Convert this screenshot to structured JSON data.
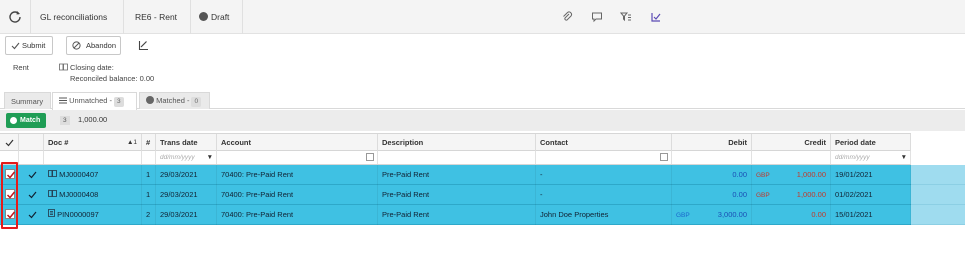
{
  "breadcrumb": {
    "root": "GL reconciliations",
    "item": "RE6 - Rent",
    "status": "Draft"
  },
  "toolbar_icons": [
    "paperclip-icon",
    "comment-icon",
    "filter-icon",
    "tasks-icon"
  ],
  "actions": {
    "submit": "Submit",
    "abandon": "Abandon"
  },
  "info": {
    "account": "Rent",
    "closing_date_label": "Closing date:",
    "reconciled_balance": "Reconciled balance: 0.00"
  },
  "tabs": [
    {
      "label": "Summary"
    },
    {
      "label": "Unmatched -",
      "count": "3"
    },
    {
      "label": "Matched -",
      "count": "0"
    }
  ],
  "match": {
    "button": "Match",
    "count": "3",
    "total": "1,000.00"
  },
  "columns": {
    "doc": "Doc #",
    "sort": "▲1",
    "num": "#",
    "trans_date": "Trans date",
    "account": "Account",
    "description": "Description",
    "contact": "Contact",
    "debit": "Debit",
    "credit": "Credit",
    "period_date": "Period date"
  },
  "filters": {
    "trans_date": "dd/mm/yyyy",
    "period_date": "dd/mm/yyyy"
  },
  "rows": [
    {
      "doc": "MJ0000407",
      "num": "1",
      "trans_date": "29/03/2021",
      "account": "70400: Pre-Paid Rent",
      "description": "Pre-Paid Rent",
      "contact": "-",
      "debit_cur": "",
      "debit": "0.00",
      "credit_cur": "GBP",
      "credit": "1,000.00",
      "period_date": "19/01/2021"
    },
    {
      "doc": "MJ0000408",
      "num": "1",
      "trans_date": "29/03/2021",
      "account": "70400: Pre-Paid Rent",
      "description": "Pre-Paid Rent",
      "contact": "-",
      "debit_cur": "",
      "debit": "0.00",
      "credit_cur": "GBP",
      "credit": "1,000.00",
      "period_date": "01/02/2021"
    },
    {
      "doc": "PIN0000097",
      "num": "2",
      "trans_date": "29/03/2021",
      "account": "70400: Pre-Paid Rent",
      "description": "Pre-Paid Rent",
      "contact": "John Doe Properties",
      "debit_cur": "GBP",
      "debit": "3,000.00",
      "credit_cur": "",
      "credit": "0.00",
      "period_date": "15/01/2021"
    }
  ],
  "colors": {
    "row_selected": "#3fc1e3",
    "match_green": "#1f9d55",
    "highlight_red": "#e41b1b"
  }
}
